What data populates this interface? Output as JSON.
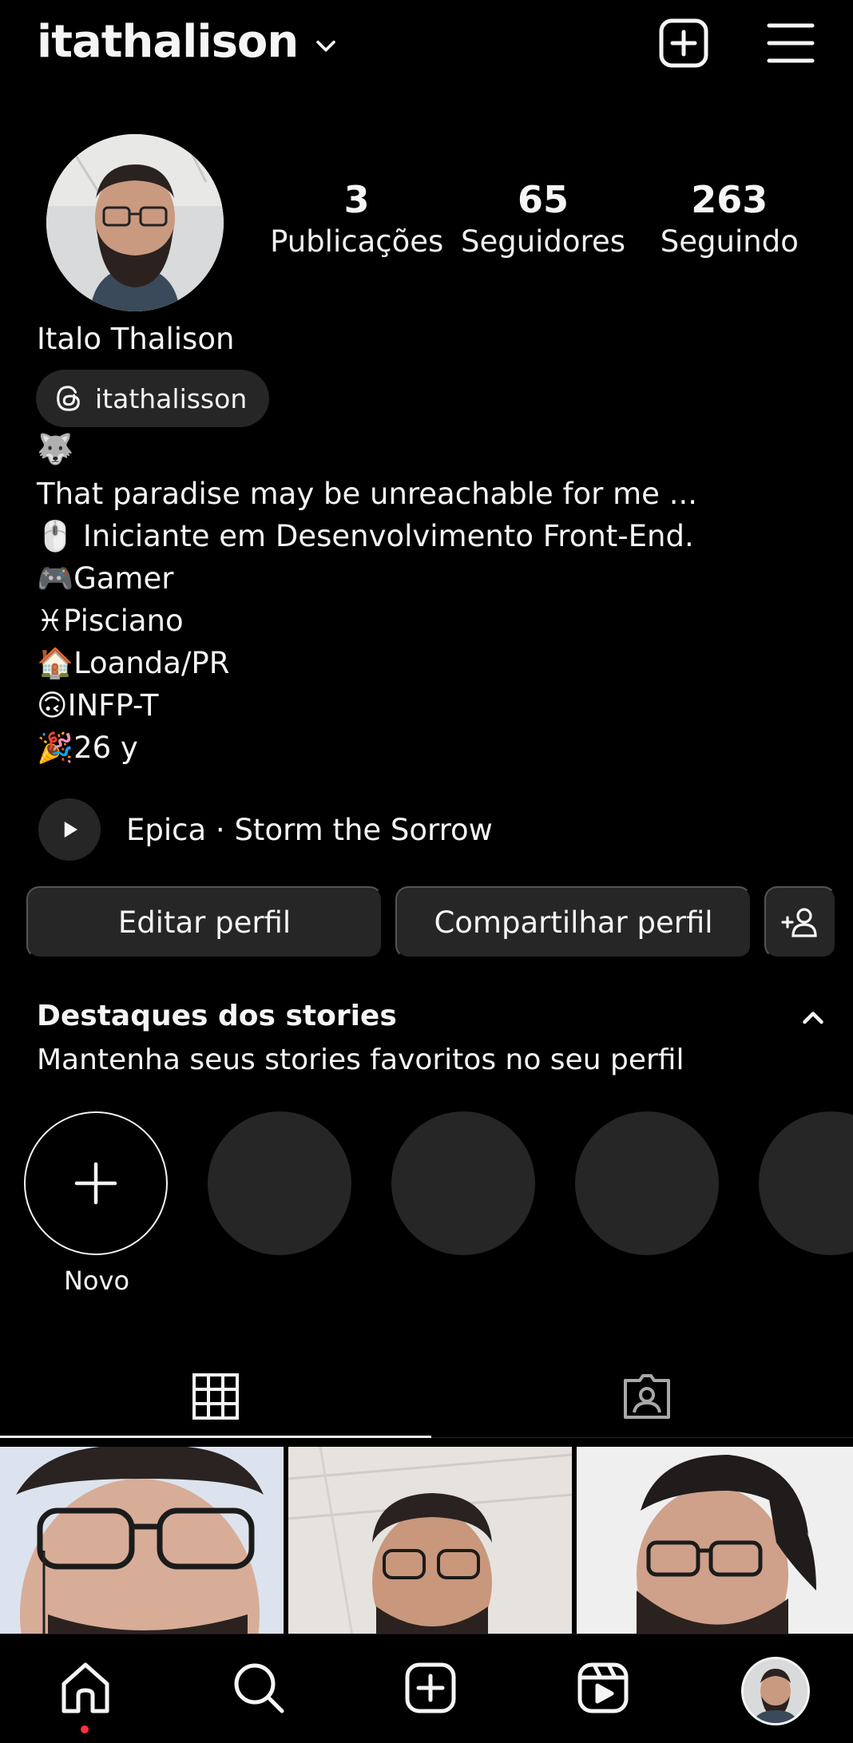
{
  "header": {
    "username": "itathalison",
    "dropdown_icon": "chevron-down-icon",
    "create_icon": "plus-square-icon",
    "menu_icon": "hamburger-menu-icon"
  },
  "profile": {
    "stats": [
      {
        "value": "3",
        "label": "Publicações"
      },
      {
        "value": "65",
        "label": "Seguidores"
      },
      {
        "value": "263",
        "label": "Seguindo"
      }
    ],
    "full_name": "Italo Thalison",
    "threads_handle": "itathalisson",
    "bio_lines": [
      "🐺",
      "That paradise may be unreachable for me ...",
      "🖱️ Iniciante em Desenvolvimento Front-End.",
      "🎮Gamer",
      "♓Pisciano",
      "🏠Loanda/PR",
      "🙃INFP-T",
      "🎉26 y"
    ],
    "music": "Epica · Storm the Sorrow"
  },
  "buttons": {
    "edit": "Editar perfil",
    "share": "Compartilhar perfil",
    "add_person_icon": "add-person-icon"
  },
  "highlights": {
    "title": "Destaques dos stories",
    "subtitle": "Mantenha seus stories favoritos no seu perfil",
    "new_label": "Novo",
    "toggle_icon": "chevron-up-icon"
  },
  "tabs": {
    "grid_icon": "grid-icon",
    "tagged_icon": "tagged-person-icon"
  },
  "nav": {
    "items": [
      "home-icon",
      "search-icon",
      "create-icon",
      "reels-icon",
      "profile-avatar"
    ]
  },
  "colors": {
    "background": "#000000",
    "surface": "#262626",
    "text": "#f5f5f5",
    "notification_dot": "#ff3040"
  }
}
